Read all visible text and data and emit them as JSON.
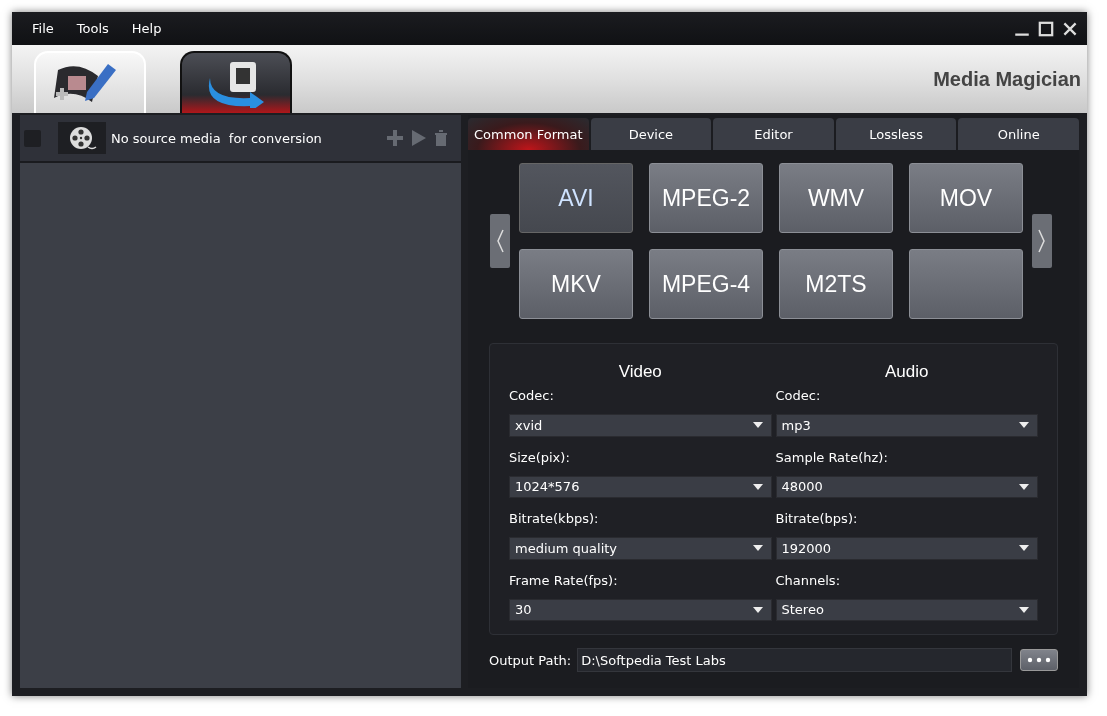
{
  "menu": [
    "File",
    "Tools",
    "Help"
  ],
  "mode_tabs": [
    {
      "kind": "edit",
      "selected": false
    },
    {
      "kind": "convert",
      "selected": true
    }
  ],
  "app_title": "Media Magician",
  "source": {
    "checked": false,
    "message": "No source media  for conversion"
  },
  "format_tabs": [
    {
      "label": "Common Format",
      "selected": true
    },
    {
      "label": "Device",
      "selected": false
    },
    {
      "label": "Editor",
      "selected": false
    },
    {
      "label": "Lossless",
      "selected": false
    },
    {
      "label": "Online",
      "selected": false
    }
  ],
  "formats": [
    {
      "label": "AVI",
      "selected": true
    },
    {
      "label": "MPEG-2",
      "selected": false
    },
    {
      "label": "WMV",
      "selected": false
    },
    {
      "label": "MOV",
      "selected": false
    },
    {
      "label": "MKV",
      "selected": false
    },
    {
      "label": "MPEG-4",
      "selected": false
    },
    {
      "label": "M2TS",
      "selected": false
    },
    {
      "selected": false
    }
  ],
  "video": {
    "heading": "Video",
    "fields": [
      {
        "label": "Codec:",
        "value": "xvid"
      },
      {
        "label": "Size(pix):",
        "value": "1024*576"
      },
      {
        "label": "Bitrate(kbps):",
        "value": "medium quality"
      },
      {
        "label": "Frame Rate(fps):",
        "value": "30"
      }
    ]
  },
  "audio": {
    "heading": "Audio",
    "fields": [
      {
        "label": "Codec:",
        "value": "mp3"
      },
      {
        "label": "Sample Rate(hz):",
        "value": "48000"
      },
      {
        "label": "Bitrate(bps):",
        "value": "192000"
      },
      {
        "label": "Channels:",
        "value": "Stereo"
      }
    ]
  },
  "output": {
    "label": "Output Path:",
    "value": "D:\\Softpedia Test Labs"
  }
}
